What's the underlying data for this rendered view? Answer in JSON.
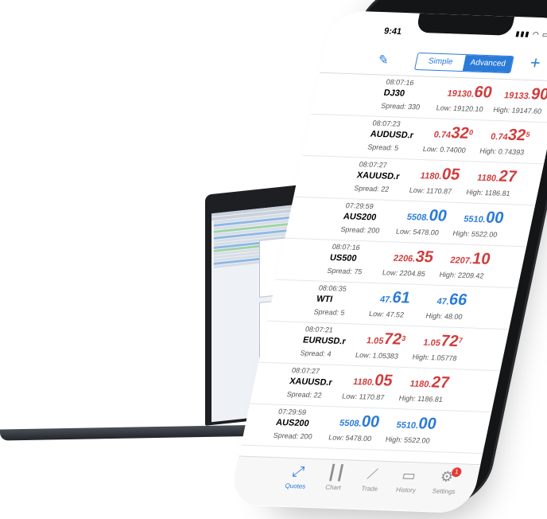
{
  "status": {
    "time": "9:41",
    "icons": "▮▮▮ ◠ ▭"
  },
  "nav": {
    "segments": [
      "Simple",
      "Advanced"
    ],
    "active_segment": "Advanced",
    "edit_icon": "pencil-icon",
    "add_icon": "plus-icon"
  },
  "quotes": [
    {
      "time": "08:07:16",
      "symbol": "DJ30",
      "spread": "Spread: 330",
      "bid_small": "19130.",
      "bid_big": "60",
      "bid_sup": "",
      "bid_color": "red",
      "ask_small": "19133.",
      "ask_big": "90",
      "ask_sup": "",
      "ask_color": "red",
      "low": "Low: 19120.10",
      "high": "High: 19147.60"
    },
    {
      "time": "08:07:23",
      "symbol": "AUDUSD.r",
      "spread": "Spread: 5",
      "bid_small": "0.74",
      "bid_big": "32",
      "bid_sup": "0",
      "bid_color": "red",
      "ask_small": "0.74",
      "ask_big": "32",
      "ask_sup": "5",
      "ask_color": "red",
      "low": "Low: 0.74000",
      "high": "High: 0.74393"
    },
    {
      "time": "08:07:27",
      "symbol": "XAUUSD.r",
      "spread": "Spread: 22",
      "bid_small": "1180.",
      "bid_big": "05",
      "bid_sup": "",
      "bid_color": "red",
      "ask_small": "1180.",
      "ask_big": "27",
      "ask_sup": "",
      "ask_color": "red",
      "low": "Low: 1170.87",
      "high": "High: 1186.81"
    },
    {
      "time": "07:29:59",
      "symbol": "AUS200",
      "spread": "Spread: 200",
      "bid_small": "5508.",
      "bid_big": "00",
      "bid_sup": "",
      "bid_color": "blue",
      "ask_small": "5510.",
      "ask_big": "00",
      "ask_sup": "",
      "ask_color": "blue",
      "low": "Low: 5478.00",
      "high": "High: 5522.00"
    },
    {
      "time": "08:07:16",
      "symbol": "US500",
      "spread": "Spread: 75",
      "bid_small": "2206.",
      "bid_big": "35",
      "bid_sup": "",
      "bid_color": "red",
      "ask_small": "2207.",
      "ask_big": "10",
      "ask_sup": "",
      "ask_color": "red",
      "low": "Low: 2204.85",
      "high": "High: 2209.42"
    },
    {
      "time": "08:06:35",
      "symbol": "WTI",
      "spread": "Spread: 5",
      "bid_small": "47.",
      "bid_big": "61",
      "bid_sup": "",
      "bid_color": "blue",
      "ask_small": "47.",
      "ask_big": "66",
      "ask_sup": "",
      "ask_color": "blue",
      "low": "Low: 47.52",
      "high": "High: 48.00"
    },
    {
      "time": "08:07:21",
      "symbol": "EURUSD.r",
      "spread": "Spread: 4",
      "bid_small": "1.05",
      "bid_big": "72",
      "bid_sup": "3",
      "bid_color": "red",
      "ask_small": "1.05",
      "ask_big": "72",
      "ask_sup": "7",
      "ask_color": "red",
      "low": "Low: 1.05383",
      "high": "High: 1.05778"
    },
    {
      "time": "08:07:27",
      "symbol": "XAUUSD.r",
      "spread": "Spread: 22",
      "bid_small": "1180.",
      "bid_big": "05",
      "bid_sup": "",
      "bid_color": "red",
      "ask_small": "1180.",
      "ask_big": "27",
      "ask_sup": "",
      "ask_color": "red",
      "low": "Low: 1170.87",
      "high": "High: 1186.81"
    },
    {
      "time": "07:29:59",
      "symbol": "AUS200",
      "spread": "Spread: 200",
      "bid_small": "5508.",
      "bid_big": "00",
      "bid_sup": "",
      "bid_color": "blue",
      "ask_small": "5510.",
      "ask_big": "00",
      "ask_sup": "",
      "ask_color": "blue",
      "low": "Low: 5478.00",
      "high": "High: 5522.00"
    }
  ],
  "tabbar": {
    "tabs": [
      {
        "label": "Quotes",
        "icon": "arrows-icon"
      },
      {
        "label": "Chart",
        "icon": "candles-icon"
      },
      {
        "label": "Trade",
        "icon": "trend-icon"
      },
      {
        "label": "History",
        "icon": "inbox-icon"
      },
      {
        "label": "Settings",
        "icon": "gear-icon"
      }
    ],
    "active": "Quotes",
    "settings_badge": "1"
  },
  "colors": {
    "accent": "#2a7bd8",
    "down": "#d13b3b",
    "up": "#2a7bd8"
  }
}
